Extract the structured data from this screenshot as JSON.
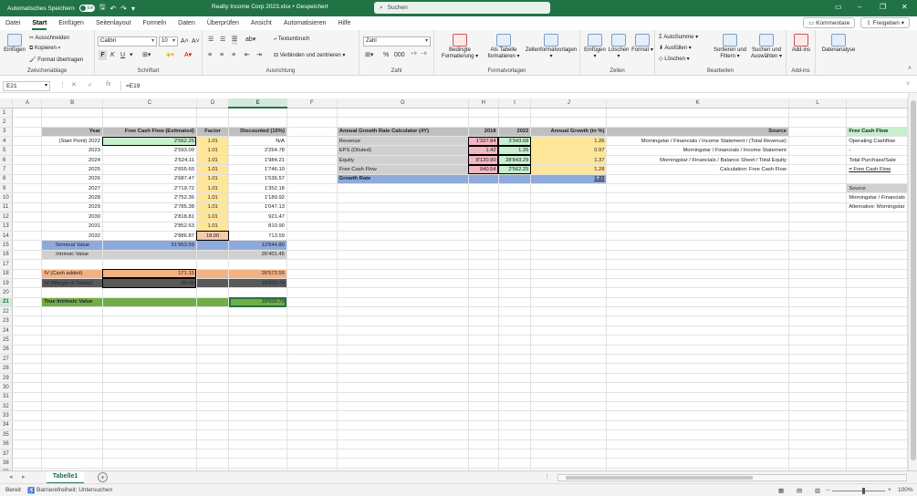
{
  "titlebar": {
    "autosave_label": "Automatisches Speichern",
    "autosave_state": "Ein",
    "title": "Realty Income Corp 2023.xlsx • Gespeichert",
    "search_placeholder": "Suchen"
  },
  "menu": {
    "items": [
      "Datei",
      "Start",
      "Einfügen",
      "Seitenlayout",
      "Formeln",
      "Daten",
      "Überprüfen",
      "Ansicht",
      "Automatisieren",
      "Hilfe"
    ],
    "active": "Start",
    "comments_label": "Kommentare",
    "share_label": "Freigeben"
  },
  "ribbon": {
    "clipboard": {
      "paste": "Einfügen",
      "cut": "Ausschneiden",
      "copy": "Kopieren",
      "format_painter": "Format übertragen",
      "label": "Zwischenablage"
    },
    "font": {
      "name": "Calibri",
      "size": "10",
      "bold": "F",
      "italic": "K",
      "underline": "U",
      "label": "Schriftart"
    },
    "alignment": {
      "wrap": "Textumbruch",
      "merge": "Verbinden und zentrieren",
      "label": "Ausrichtung"
    },
    "number": {
      "format": "Zahl",
      "label": "Zahl"
    },
    "styles": {
      "conditional": "Bedingte Formatierung",
      "as_table": "Als Tabelle formatieren",
      "cell_styles": "Zellenformatvorlagen",
      "label": "Formatvorlagen"
    },
    "cells": {
      "insert": "Einfügen",
      "delete": "Löschen",
      "format": "Format",
      "label": "Zellen"
    },
    "editing": {
      "autosum": "AutoSumme",
      "fill": "Ausfüllen",
      "clear": "Löschen",
      "sort": "Sortieren und Filtern",
      "find": "Suchen und Auswählen",
      "label": "Bearbeiten"
    },
    "addins": {
      "addins": "Add-ins",
      "label": "Add-ins"
    },
    "analysis": {
      "data_analysis": "Datenanalyse"
    }
  },
  "formula_bar": {
    "cell_ref": "E21",
    "formula": "=E19"
  },
  "columns": [
    "A",
    "B",
    "C",
    "D",
    "E",
    "F",
    "G",
    "H",
    "I",
    "J",
    "K",
    "L",
    ""
  ],
  "rows": {
    "r3": {
      "B": "Year",
      "C": "Free Cash Flow (Estimated)",
      "D": "Factor",
      "E": "Discounted (15%)",
      "G": "Annual Growth Rate Calculator (4Y)",
      "H": "2018",
      "I": "2022",
      "J": "Annual Growth (in %)",
      "K": "Source",
      "M": "Free Cash Flow"
    },
    "r4": {
      "B": "(Start Point) 2022",
      "C": "2'562.25",
      "D": "1.01",
      "E": "N/A",
      "G": "Revenue",
      "H": "1'327.84",
      "I": "3'343.68",
      "J": "1.26",
      "K": "Morningstar / Financials / Income Statement / (Total Revenue)",
      "M": "Operating Cashflow"
    },
    "r5": {
      "B": "2023",
      "C": "2'593.00",
      "D": "1.01",
      "E": "2'254.78",
      "G": "EPS (Diluted)",
      "H": "1.42",
      "I": "1.26",
      "J": "0.97",
      "K": "Morningstar / Financials / Income Statement",
      "M": "-"
    },
    "r6": {
      "B": "2024",
      "C": "2'624.11",
      "D": "1.01",
      "E": "1'984.21",
      "G": "Equity",
      "H": "8'120.90",
      "I": "28'843.29",
      "J": "1.37",
      "K": "Morningstar / Financials / Balance Sheet / Total Equity",
      "M": "Total Purchase/Sale"
    },
    "r7": {
      "B": "2025",
      "C": "2'655.60",
      "D": "1.01",
      "E": "1'746.10",
      "G": "Free Cash Flow",
      "H": "940.54",
      "I": "2'562.25",
      "J": "1.28",
      "K": "Calculation: Free Cash Flow",
      "M": "= Free Cash Flow"
    },
    "r8": {
      "B": "2026",
      "C": "2'687.47",
      "D": "1.01",
      "E": "1'536.57",
      "G": "Growth Rate",
      "J": "1.22"
    },
    "r9": {
      "B": "2027",
      "C": "2'719.72",
      "D": "1.01",
      "E": "1'352.18",
      "M": "Source"
    },
    "r10": {
      "B": "2028",
      "C": "2'752.36",
      "D": "1.01",
      "E": "1'189.92",
      "M": "Morningstar / Financials"
    },
    "r11": {
      "B": "2029",
      "C": "2'785.38",
      "D": "1.01",
      "E": "1'047.13",
      "M": "Alternative: Morningstar"
    },
    "r12": {
      "B": "2030",
      "C": "2'818.81",
      "D": "1.01",
      "E": "921.47"
    },
    "r13": {
      "B": "2031",
      "C": "2'852.63",
      "D": "1.01",
      "E": "810.90"
    },
    "r14": {
      "B": "2032",
      "C": "2'886.87",
      "D": "18.00",
      "E": "713.59"
    },
    "r15": {
      "B": "Terminal Value",
      "C": "51'963.59",
      "E": "12'844.80"
    },
    "r16": {
      "B": "Intrinsic Value",
      "E": "26'401.45"
    },
    "r18": {
      "B": "IV (Cash added)",
      "C": "171.15",
      "E": "26'572.55"
    },
    "r19": {
      "B": "IV (Margin of Safety)",
      "C": "30.00",
      "E": "18'600.79"
    },
    "r21": {
      "B": "True Intrinsic Value",
      "E": "18'600.79"
    }
  },
  "sheet_tab": "Tabelle1",
  "status": {
    "ready": "Bereit",
    "accessibility": "Barrierefreiheit: Untersuchen",
    "zoom": "100%"
  }
}
